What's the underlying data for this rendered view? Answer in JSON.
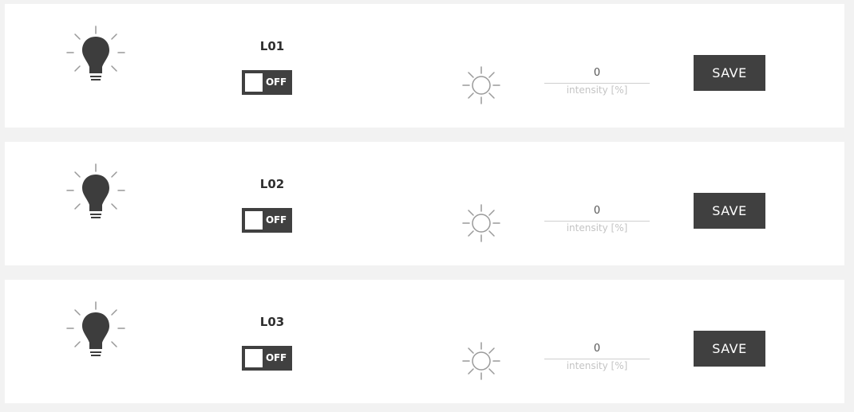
{
  "lights": [
    {
      "name": "L01",
      "switch_state": "OFF",
      "intensity_value": "0",
      "intensity_label": "intensity [%]",
      "save_label": "SAVE"
    },
    {
      "name": "L02",
      "switch_state": "OFF",
      "intensity_value": "0",
      "intensity_label": "intensity [%]",
      "save_label": "SAVE"
    },
    {
      "name": "L03",
      "switch_state": "OFF",
      "intensity_value": "0",
      "intensity_label": "intensity [%]",
      "save_label": "SAVE"
    }
  ],
  "icons": {
    "status": "light-bulb-icon",
    "brightness": "sun-icon"
  },
  "colors": {
    "dark": "#404040",
    "panel": "#ffffff",
    "background": "#f2f2f2"
  }
}
